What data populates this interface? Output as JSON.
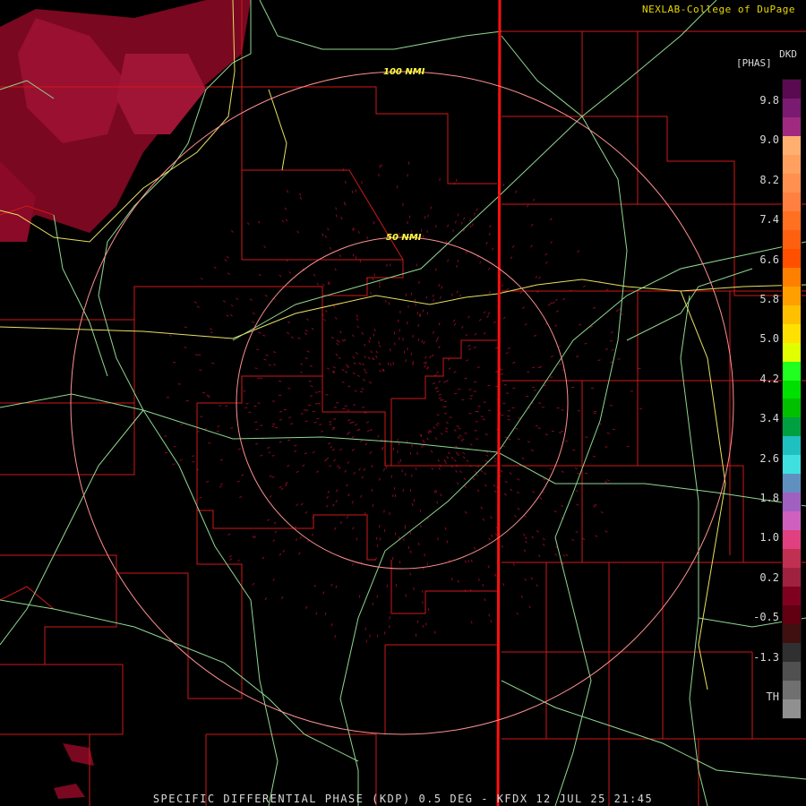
{
  "credit": "NEXLAB-College of DuPage",
  "footer": "SPECIFIC DIFFERENTIAL PHASE (KDP) 0.5 DEG - KFDX 12 JUL 25 21:45",
  "legend": {
    "product": "DKD",
    "unit": "[PHAS]",
    "ticks": [
      "9.8",
      "9.0",
      "8.2",
      "7.4",
      "6.6",
      "5.8",
      "5.0",
      "4.2",
      "3.4",
      "2.6",
      "1.8",
      "1.0",
      "0.2",
      "-0.5",
      "-1.3",
      "TH"
    ],
    "colors": [
      "#5a0a50",
      "#7a1a70",
      "#a02a80",
      "#ffb070",
      "#ffa060",
      "#ff9050",
      "#ff8040",
      "#ff7020",
      "#ff6010",
      "#ff5000",
      "#ff8000",
      "#ffa000",
      "#ffc000",
      "#ffe000",
      "#e0ff00",
      "#20ff20",
      "#00e000",
      "#00c000",
      "#00a040",
      "#20c0c0",
      "#40e0e0",
      "#6090c0",
      "#a060c0",
      "#d060c0",
      "#e04080",
      "#c03050",
      "#a02040",
      "#800020",
      "#600010",
      "#401010",
      "#303030",
      "#505050",
      "#707070",
      "#909090"
    ]
  },
  "map": {
    "range_rings": [
      "100 NMI",
      "50 NMI"
    ],
    "colors": {
      "county": "#d01818",
      "state": "#ff1010",
      "highway": "#90d890",
      "interstate": "#e8e060",
      "ring": "#ff9090",
      "echo": "#8a0a24"
    }
  }
}
